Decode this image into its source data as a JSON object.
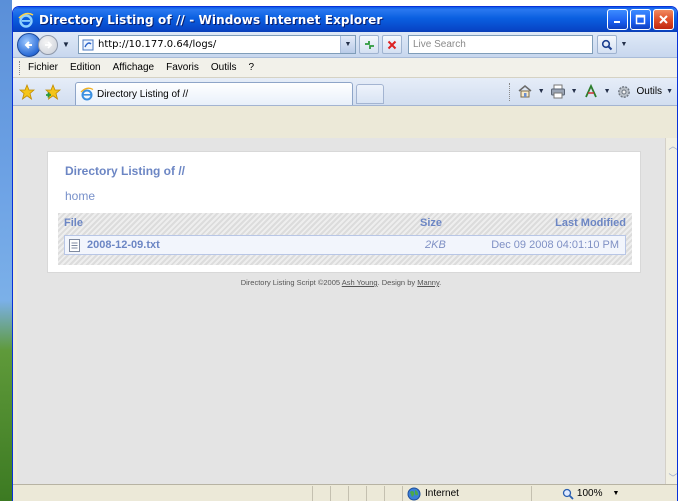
{
  "window": {
    "title": "Directory Listing of // - Windows Internet Explorer"
  },
  "address_bar": {
    "url": "http://10.177.0.64/logs/",
    "search_placeholder": "Live Search"
  },
  "menu": {
    "items": [
      "Fichier",
      "Edition",
      "Affichage",
      "Favoris",
      "Outils",
      "?"
    ]
  },
  "tab": {
    "label": "Directory Listing of //"
  },
  "command_bar": {
    "tools_label": "Outils"
  },
  "page": {
    "heading": "Directory Listing of //",
    "home_link": "home",
    "columns": {
      "file": "File",
      "size": "Size",
      "modified": "Last Modified"
    },
    "files": [
      {
        "name": "2008-12-09.txt",
        "size": "2KB",
        "modified": "Dec 09 2008 04:01:10 PM"
      }
    ],
    "credit": {
      "prefix": "Directory Listing Script ©2005 ",
      "author": "Ash Young",
      "middle": ". Design by ",
      "designer": "Manny",
      "suffix": "."
    }
  },
  "status_bar": {
    "zone": "Internet",
    "zoom": "100%"
  },
  "colors": {
    "titlebar": "#0a58e8",
    "link": "#6c86c4",
    "content_bg": "#e4e4e4"
  }
}
